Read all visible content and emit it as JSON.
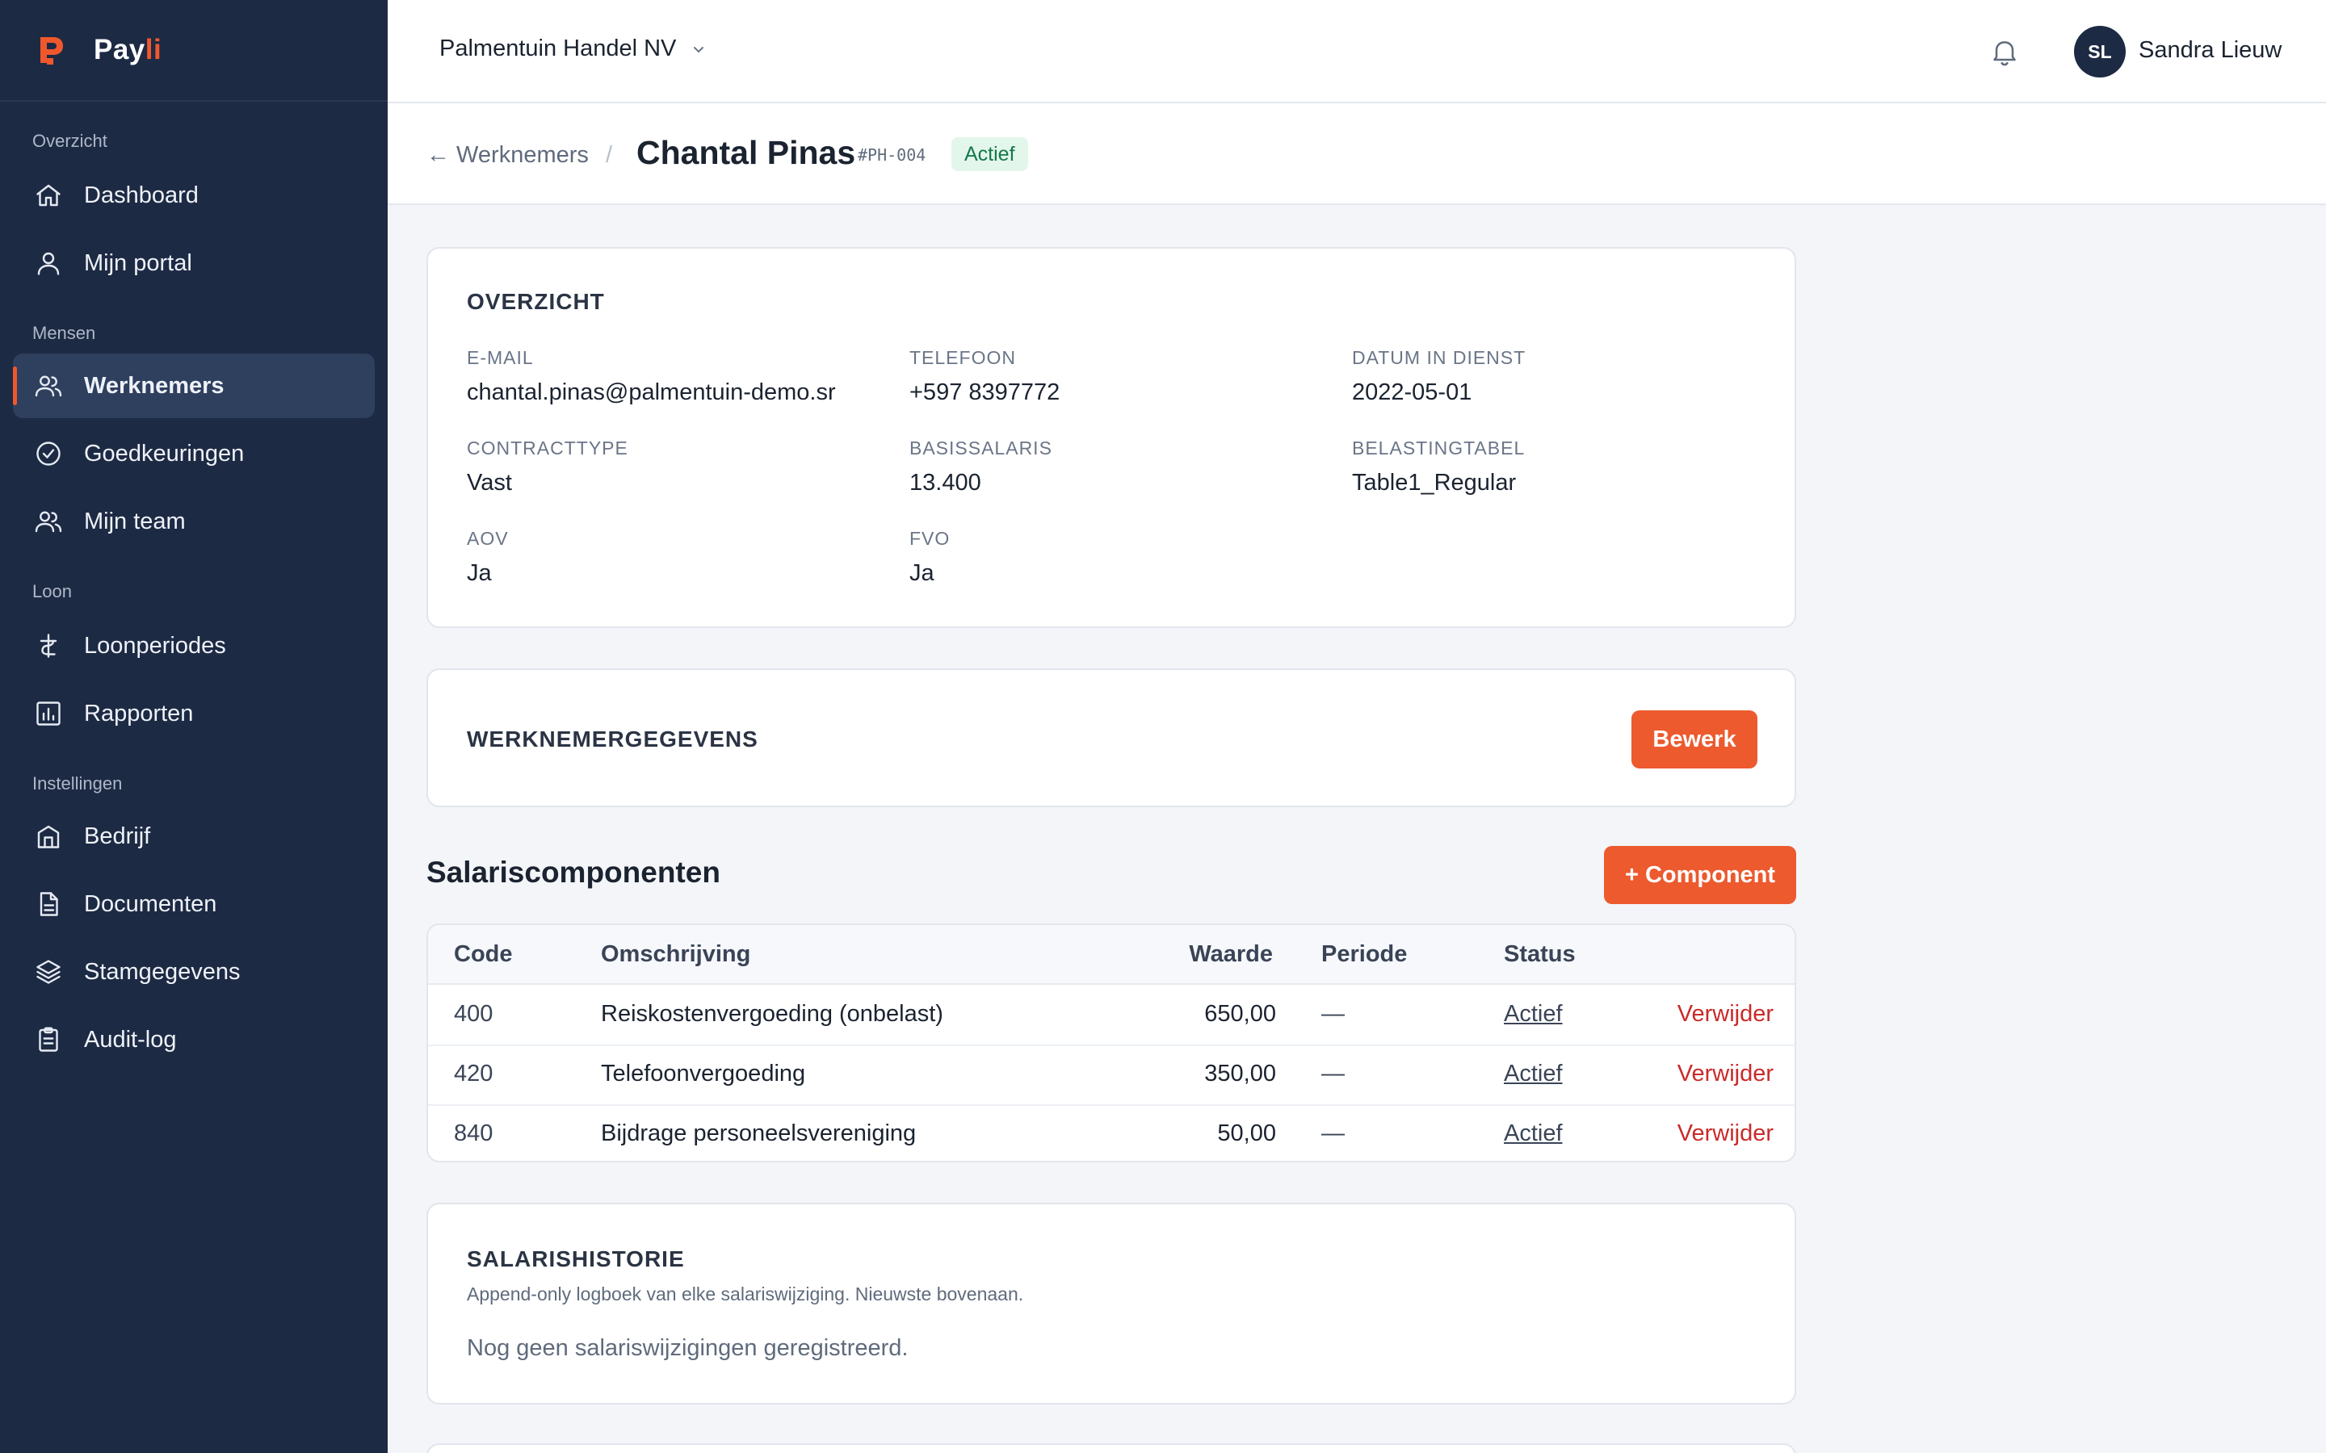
{
  "brand": {
    "name_main": "Pay",
    "name_accent": "li"
  },
  "sidebar": {
    "groups": [
      {
        "label": "Overzicht",
        "items": [
          {
            "label": "Dashboard",
            "icon": "home-icon"
          },
          {
            "label": "Mijn portal",
            "icon": "user-icon"
          }
        ]
      },
      {
        "label": "Mensen",
        "items": [
          {
            "label": "Werknemers",
            "icon": "users-icon",
            "active": true
          },
          {
            "label": "Goedkeuringen",
            "icon": "check-circle-icon"
          },
          {
            "label": "Mijn team",
            "icon": "users-icon"
          }
        ]
      },
      {
        "label": "Loon",
        "items": [
          {
            "label": "Loonperiodes",
            "icon": "currency-icon"
          },
          {
            "label": "Rapporten",
            "icon": "bar-chart-icon"
          }
        ]
      },
      {
        "label": "Instellingen",
        "items": [
          {
            "label": "Bedrijf",
            "icon": "building-icon"
          },
          {
            "label": "Documenten",
            "icon": "document-icon"
          },
          {
            "label": "Stamgegevens",
            "icon": "layers-icon"
          },
          {
            "label": "Audit-log",
            "icon": "clipboard-icon"
          }
        ]
      }
    ]
  },
  "topbar": {
    "company": "Palmentuin Handel NV",
    "user_initials": "SL",
    "user_name": "Sandra Lieuw"
  },
  "header": {
    "back_label": "← Werknemers",
    "separator": "/",
    "title": "Chantal Pinas",
    "code": "#PH-004",
    "status": "Actief"
  },
  "overview": {
    "title": "OVERZICHT",
    "fields": [
      {
        "label": "E-MAIL",
        "value": "chantal.pinas@palmentuin-demo.sr"
      },
      {
        "label": "TELEFOON",
        "value": "+597 8397772"
      },
      {
        "label": "DATUM IN DIENST",
        "value": "2022-05-01"
      },
      {
        "label": "CONTRACTTYPE",
        "value": "Vast"
      },
      {
        "label": "BASISSALARIS",
        "value": "13.400"
      },
      {
        "label": "BELASTINGTABEL",
        "value": "Table1_Regular"
      },
      {
        "label": "AOV",
        "value": "Ja"
      },
      {
        "label": "FVO",
        "value": "Ja"
      }
    ]
  },
  "employee_data": {
    "title": "WERKNEMERGEGEVENS",
    "edit_label": "Bewerk"
  },
  "components": {
    "title": "Salariscomponenten",
    "add_label": "+ Component",
    "columns": [
      "Code",
      "Omschrijving",
      "Waarde",
      "Periode",
      "Status"
    ],
    "rows": [
      {
        "code": "400",
        "description": "Reiskostenvergoeding (onbelast)",
        "value": "650,00",
        "period": "—",
        "status": "Actief",
        "action": "Verwijder"
      },
      {
        "code": "420",
        "description": "Telefoonvergoeding",
        "value": "350,00",
        "period": "—",
        "status": "Actief",
        "action": "Verwijder"
      },
      {
        "code": "840",
        "description": "Bijdrage personeelsvereniging",
        "value": "50,00",
        "period": "—",
        "status": "Actief",
        "action": "Verwijder"
      }
    ]
  },
  "history": {
    "title": "SALARISHISTORIE",
    "subtitle": "Append-only logboek van elke salariswijziging. Nieuwste bovenaan.",
    "empty": "Nog geen salariswijzigingen geregistreerd."
  },
  "colors": {
    "sidebar": "#1d2a44",
    "accent": "#ec5a2e",
    "success": "#15794a",
    "danger": "#c92a2a"
  }
}
